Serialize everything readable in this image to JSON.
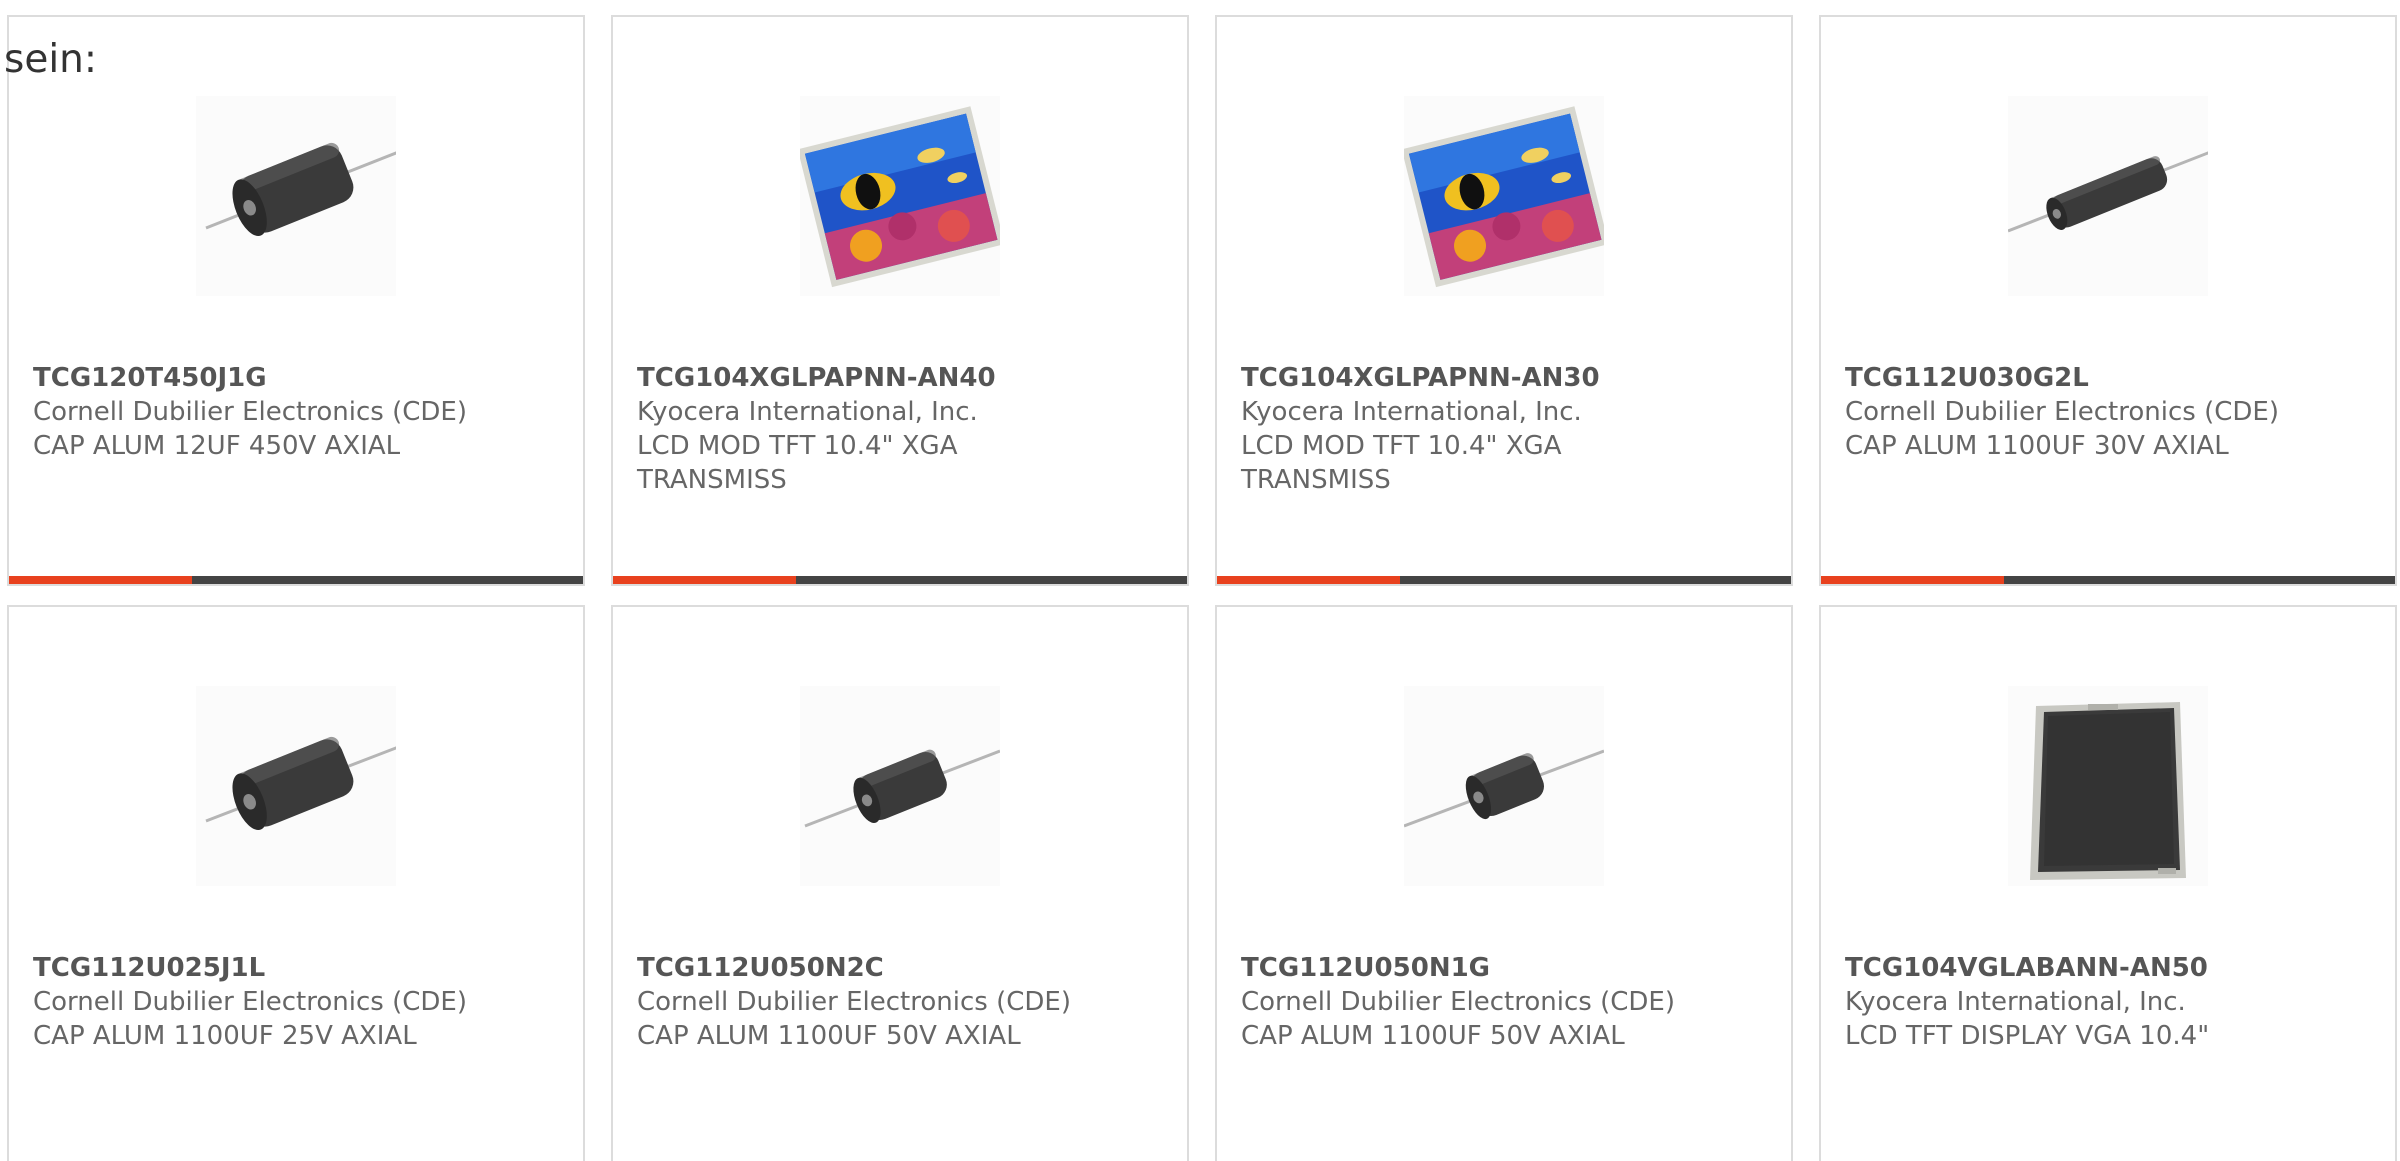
{
  "lead_text": "sein:",
  "colors": {
    "accent": "#e8411e",
    "bar": "#444444",
    "border": "#dcdcdc"
  },
  "products": [
    {
      "part_number": "TCG120T450J1G",
      "manufacturer": "Cornell Dubilier Electronics (CDE)",
      "description": "CAP ALUM 12UF 450V AXIAL",
      "image_icon": "axial-capacitor-icon"
    },
    {
      "part_number": "TCG104XGLPAPNN-AN40",
      "manufacturer": "Kyocera International, Inc.",
      "description": "LCD MOD TFT 10.4\" XGA TRANSMISS",
      "image_icon": "lcd-module-icon"
    },
    {
      "part_number": "TCG104XGLPAPNN-AN30",
      "manufacturer": "Kyocera International, Inc.",
      "description": "LCD MOD TFT 10.4\" XGA TRANSMISS",
      "image_icon": "lcd-module-icon"
    },
    {
      "part_number": "TCG112U030G2L",
      "manufacturer": "Cornell Dubilier Electronics (CDE)",
      "description": "CAP ALUM 1100UF 30V AXIAL",
      "image_icon": "axial-capacitor-icon"
    },
    {
      "part_number": "TCG112U025J1L",
      "manufacturer": "Cornell Dubilier Electronics (CDE)",
      "description": "CAP ALUM 1100UF 25V AXIAL",
      "image_icon": "axial-capacitor-icon"
    },
    {
      "part_number": "TCG112U050N2C",
      "manufacturer": "Cornell Dubilier Electronics (CDE)",
      "description": "CAP ALUM 1100UF 50V AXIAL",
      "image_icon": "axial-capacitor-icon"
    },
    {
      "part_number": "TCG112U050N1G",
      "manufacturer": "Cornell Dubilier Electronics (CDE)",
      "description": "CAP ALUM 1100UF 50V AXIAL",
      "image_icon": "axial-capacitor-icon"
    },
    {
      "part_number": "TCG104VGLABANN-AN50",
      "manufacturer": "Kyocera International, Inc.",
      "description": "LCD TFT DISPLAY VGA 10.4\"",
      "image_icon": "lcd-display-panel-icon"
    }
  ]
}
